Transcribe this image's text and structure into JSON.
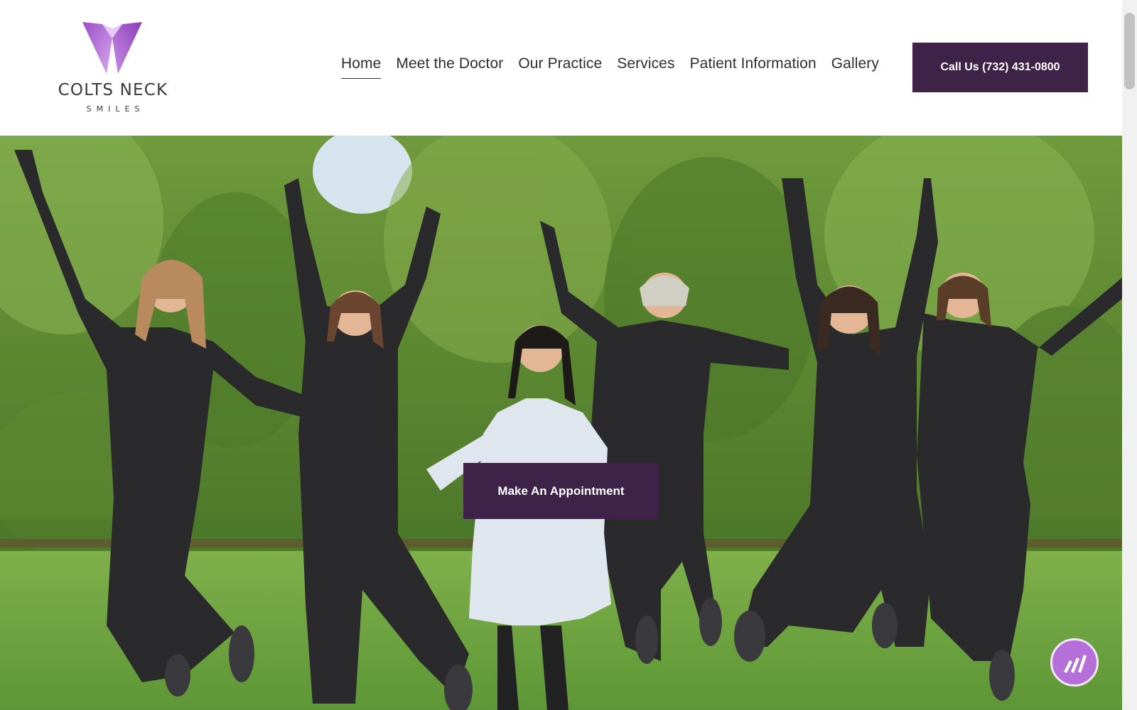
{
  "logo": {
    "name": "COLTS NECK",
    "sub": "SMILES",
    "icon": "tooth-icon"
  },
  "nav": {
    "items": [
      {
        "label": "Home",
        "active": true
      },
      {
        "label": "Meet the Doctor"
      },
      {
        "label": "Our Practice"
      },
      {
        "label": "Services"
      },
      {
        "label": "Patient Information"
      },
      {
        "label": "Gallery"
      }
    ]
  },
  "header": {
    "call_label": "Call Us (732) 431-0800"
  },
  "hero": {
    "appointment_label": "Make An Appointment",
    "image": "team-jumping-photo"
  },
  "chat": {
    "icon": "chat-bars-icon"
  },
  "colors": {
    "brand": "#3f2247",
    "accent": "#b46fd8"
  }
}
